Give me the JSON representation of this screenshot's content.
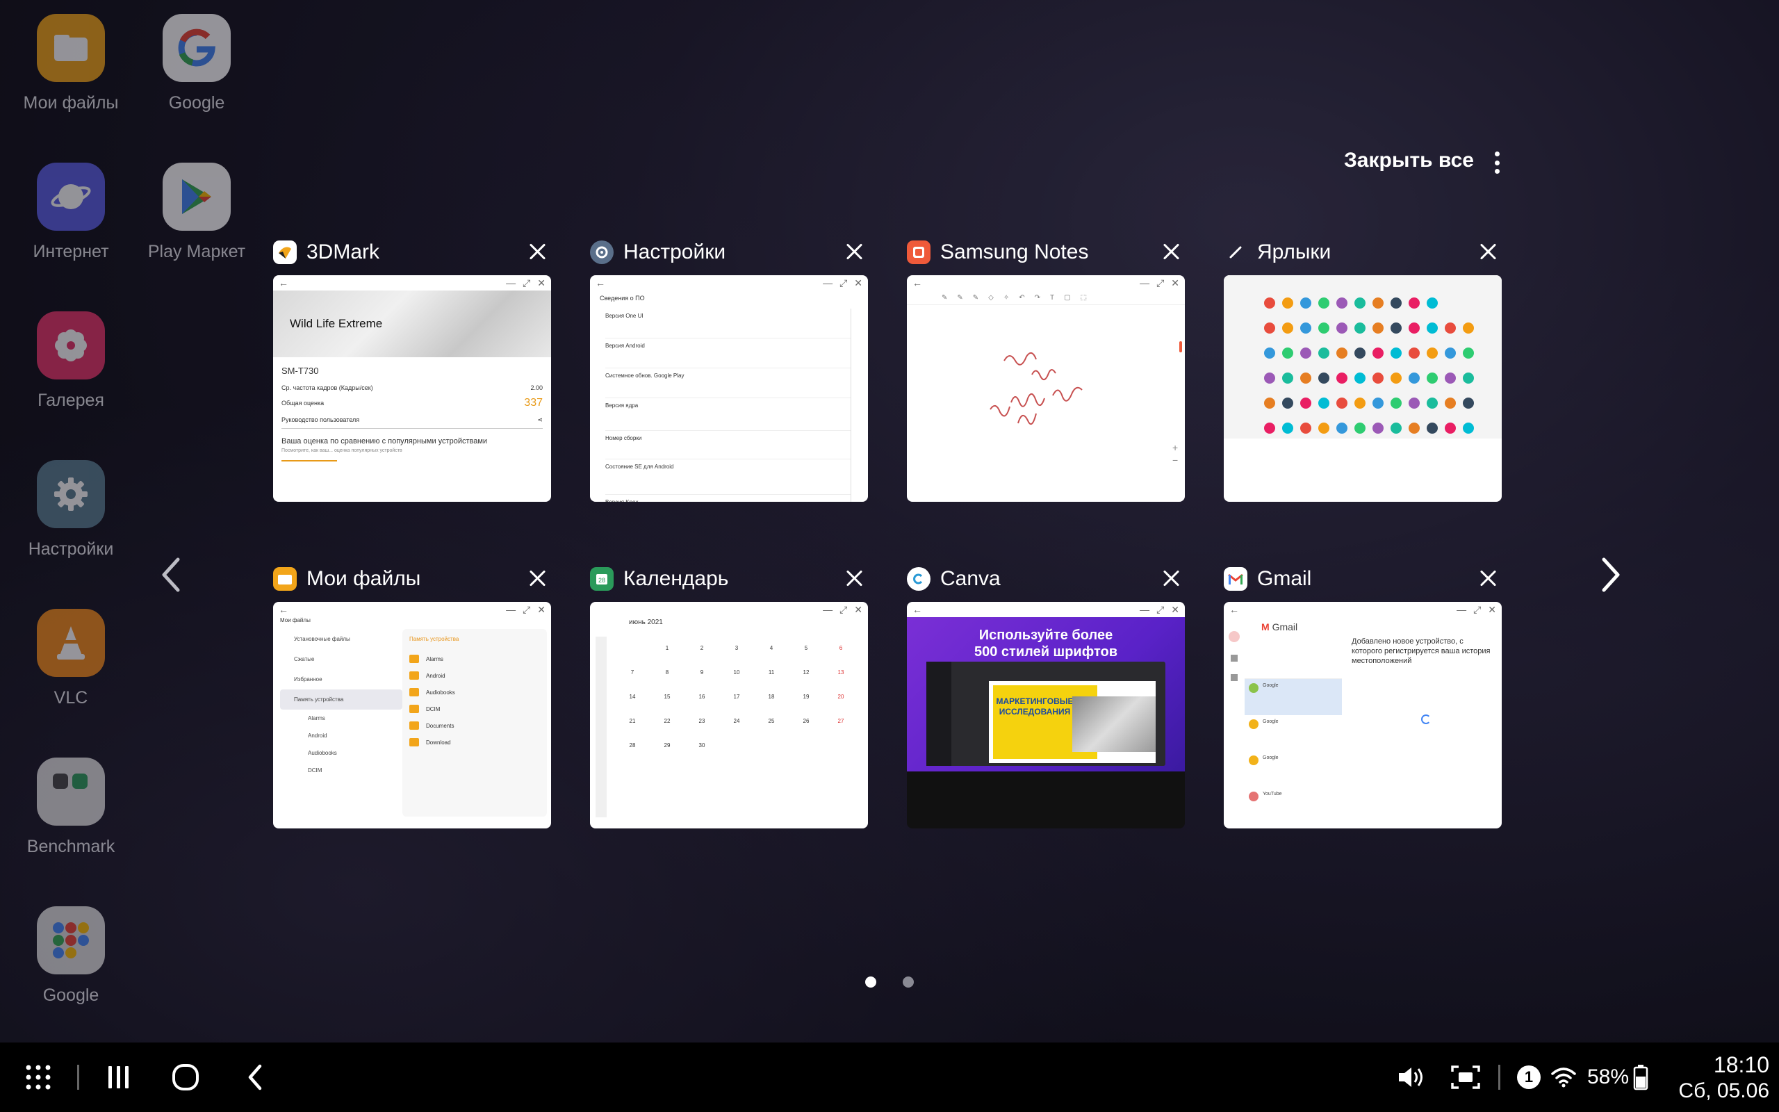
{
  "home_icons": [
    {
      "label": "Мои файлы",
      "icon": "folder-icon",
      "color": "#f2a51a"
    },
    {
      "label": "Google",
      "icon": "google-g-icon",
      "color": "#ffffff"
    },
    {
      "label": "Интернет",
      "icon": "samsung-internet-icon",
      "color": "#5b5ee6"
    },
    {
      "label": "Play Маркет",
      "icon": "play-store-icon",
      "color": "#ffffff"
    },
    {
      "label": "Галерея",
      "icon": "gallery-flower-icon",
      "color": "#e8356b"
    },
    {
      "label": "Настройки",
      "icon": "gear-icon",
      "color": "#5a7d92"
    },
    {
      "label": "VLC",
      "icon": "vlc-cone-icon",
      "color": "#f28a1a"
    },
    {
      "label": "Benchmark",
      "icon": "folder-group-icon",
      "color": "#dcdcdc"
    },
    {
      "label": "Google",
      "icon": "google-folder-icon",
      "color": "#dcdcdc"
    }
  ],
  "recents": {
    "close_all": "Закрыть все",
    "cards": [
      {
        "title": "3DMark",
        "icon_color": "#ffffff"
      },
      {
        "title": "Настройки",
        "icon_color": "#5a6f8a"
      },
      {
        "title": "Samsung Notes",
        "icon_color": "#ef5a3a"
      },
      {
        "title": "Ярлыки",
        "icon_color": "#2a2a2a"
      },
      {
        "title": "Мои файлы",
        "icon_color": "#f2a51a"
      },
      {
        "title": "Календарь",
        "icon_color": "#2a9a5a"
      },
      {
        "title": "Canva",
        "icon_color": "#ffffff"
      },
      {
        "title": "Gmail",
        "icon_color": "#ffffff"
      }
    ],
    "thumbs": {
      "mark3d": {
        "heading": "Wild Life Extreme",
        "device": "SM-T730",
        "row1": "Ср. частота кадров (Кадры/сек)",
        "row1_val": "2.00",
        "score_label": "Общая оценка",
        "score": "337",
        "guide": "Руководство пользователя",
        "compare": "Ваша оценка по сравнению с популярными устройствами",
        "compare_sub": "Посмотрите, как ваш... оценка популярных устройств"
      },
      "settings": {
        "heading": "Сведения о ПО",
        "items": [
          "Версия One UI",
          "Версия Android",
          "Системное обнов. Google Play",
          "Версия ядра",
          "Номер сборки",
          "Состояние SE для Android",
          "Версия Knox"
        ]
      },
      "files": {
        "header": "Мои файлы",
        "side": [
          "Установочные файлы",
          "Сжатые",
          "Избранное",
          "Память устройства",
          "Alarms",
          "Android",
          "Audiobooks",
          "DCIM"
        ],
        "main_title": "Память устройства",
        "list": [
          "Alarms",
          "Android",
          "Audiobooks",
          "DCIM",
          "Documents",
          "Download"
        ]
      },
      "calendar": {
        "month": "июнь 2021",
        "days": [
          "1",
          "2",
          "3",
          "4",
          "5",
          "6",
          "7",
          "8",
          "9",
          "10",
          "11",
          "12",
          "13",
          "14",
          "15",
          "16",
          "17",
          "18",
          "19",
          "20",
          "21",
          "22",
          "23",
          "24",
          "25",
          "26",
          "27",
          "28",
          "29",
          "30"
        ]
      },
      "canva": {
        "headline1": "Используйте более",
        "headline2": "500 стилей шрифтов",
        "poster1": "МАРКЕТИНГОВЫЕ",
        "poster2": "ИССЛЕДОВАНИЯ"
      },
      "gmail": {
        "logo": "Gmail",
        "msg": "Добавлено новое устройство, с которого регистрируется ваша история местоположений",
        "sender1": "Google",
        "sender2": "Google",
        "sender3": "Google",
        "sender4": "YouTube"
      }
    }
  },
  "status": {
    "time": "18:10",
    "date": "Сб, 05.06",
    "battery": "58%",
    "notif_count": "1"
  }
}
